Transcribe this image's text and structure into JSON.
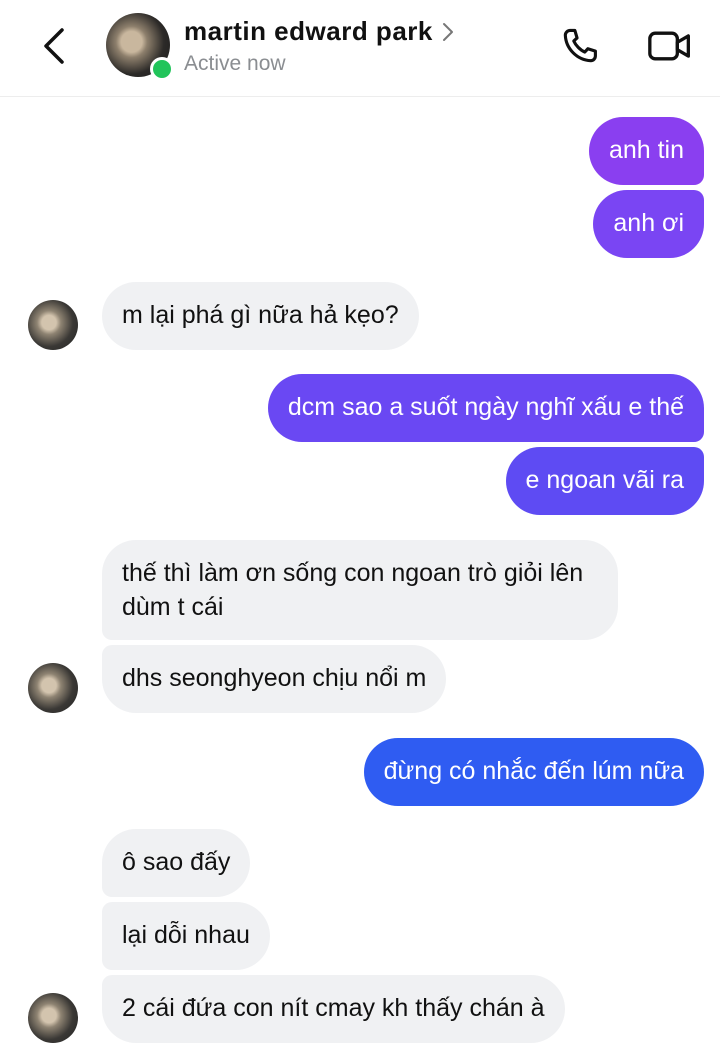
{
  "header": {
    "contact_name": "martin edward park",
    "status": "Active now",
    "colors": {
      "online": "#21c45a",
      "status_text": "#8a8d91"
    },
    "icons": [
      "back-arrow-icon",
      "chevron-right-icon",
      "phone-icon",
      "video-camera-icon"
    ]
  },
  "messages": [
    {
      "side": "out",
      "text": "anh tin",
      "color": "#8a3ff0"
    },
    {
      "side": "out",
      "text": "anh ơi",
      "color": "#7a45f3"
    },
    {
      "side": "in",
      "text": "m lại phá gì nữa hả kẹo?"
    },
    {
      "side": "out",
      "text": "dcm sao a suốt ngày nghĩ xấu e thế",
      "color": "#6a48f3"
    },
    {
      "side": "out",
      "text": "e ngoan vãi ra",
      "color": "#5e4bf3"
    },
    {
      "side": "in",
      "text": "thế thì làm ơn sống con ngoan trò giỏi lên dùm t cái"
    },
    {
      "side": "in",
      "text": "dhs seonghyeon chịu nổi m"
    },
    {
      "side": "out",
      "text": "đừng có nhắc đến lúm nữa",
      "color": "#2f5cf2"
    },
    {
      "side": "in",
      "text": "ô sao đấy"
    },
    {
      "side": "in",
      "text": "lại dỗi nhau"
    },
    {
      "side": "in",
      "text": "2 cái đứa con nít cmay kh thấy chán à"
    }
  ]
}
